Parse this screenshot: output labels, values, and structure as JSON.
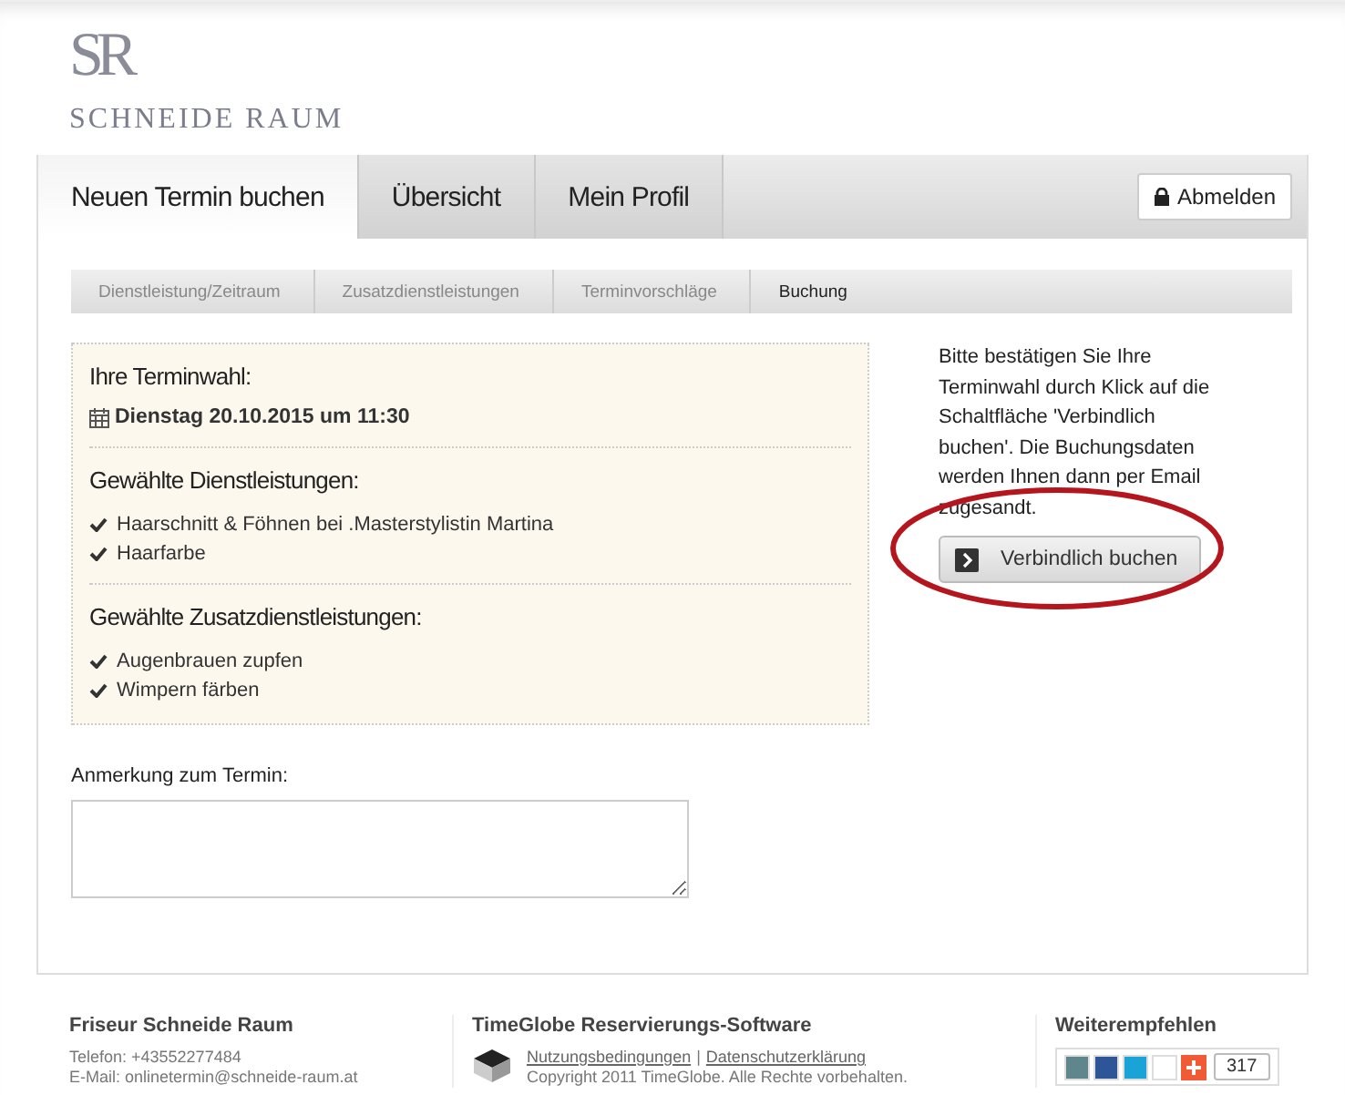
{
  "logo": {
    "monogram": "SR",
    "name": "SCHNEIDE RAUM"
  },
  "tabs": [
    {
      "label": "Neuen Termin buchen",
      "selected": true
    },
    {
      "label": "Übersicht",
      "selected": false
    },
    {
      "label": "Mein Profil",
      "selected": false
    }
  ],
  "logout_button": "Abmelden",
  "steps": [
    {
      "label": "Dienstleistung/Zeitraum",
      "selected": false
    },
    {
      "label": "Zusatzdienstleistungen",
      "selected": false
    },
    {
      "label": "Terminvorschläge",
      "selected": false
    },
    {
      "label": "Buchung",
      "selected": true
    }
  ],
  "summary": {
    "heading": "Ihre Terminwahl:",
    "date": "Dienstag 20.10.2015 um 11:30",
    "sections": [
      {
        "heading": "Gewählte Dienstleistungen:",
        "items": [
          "Haarschnitt & Föhnen bei .Masterstylistin Martina",
          "Haarfarbe"
        ]
      },
      {
        "heading": "Gewählte Zusatzdienstleistungen:",
        "items": [
          "Augenbrauen zupfen",
          "Wimpern färben"
        ]
      }
    ]
  },
  "confirm": {
    "text": "Bitte bestätigen Sie Ihre Terminwahl durch Klick auf die Schaltfläche 'Verbindlich buchen'. Die Buchungsdaten werden Ihnen dann per Email zugesandt.",
    "button": "Verbindlich buchen",
    "highlighted": true
  },
  "note": {
    "label": "Anmerkung zum Termin:"
  },
  "footer": {
    "salon": {
      "title": "Friseur Schneide Raum",
      "phone": "Telefon: +43552277484",
      "email": "E-Mail: onlinetermin@schneide-raum.at"
    },
    "software": {
      "title": "TimeGlobe Reservierungs-Software",
      "links": [
        "Nutzungsbedingungen",
        "Datenschutzerklärung"
      ],
      "separator": "|",
      "copyright": "Copyright 2011 TimeGlobe. Alle Rechte vorbehalten."
    },
    "share": {
      "title": "Weiterempfehlen",
      "buttons": [
        {
          "kind": "square",
          "color": "#5f868c"
        },
        {
          "kind": "square",
          "color": "#2e5598"
        },
        {
          "kind": "square",
          "color": "#1aa3d6"
        },
        {
          "kind": "square",
          "color": "#ffffff"
        },
        {
          "kind": "plus",
          "color": "#f05a35"
        }
      ],
      "count": "317"
    }
  }
}
